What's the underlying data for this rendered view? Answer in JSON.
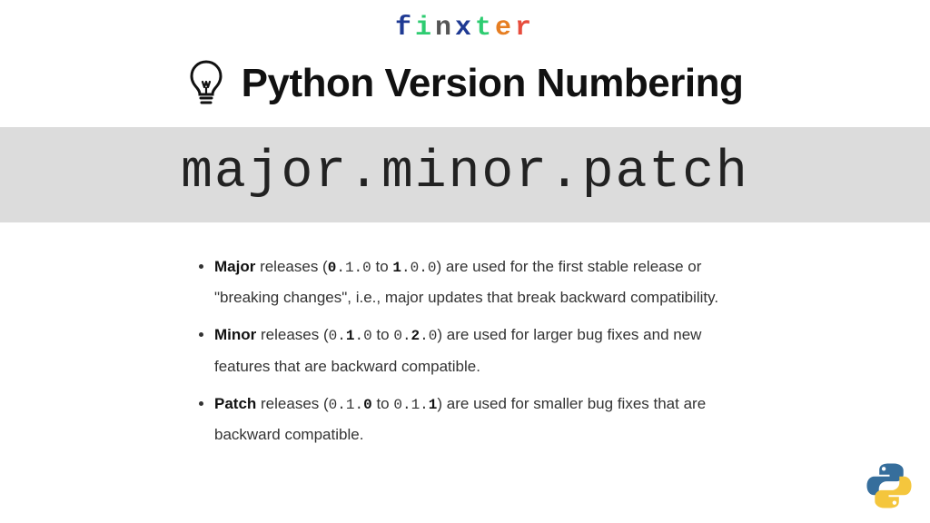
{
  "brand": {
    "letters": [
      "f",
      "i",
      "n",
      "x",
      "t",
      "e",
      "r"
    ],
    "colors": [
      "#1f3a93",
      "#2ecc71",
      "#555555",
      "#1f3a93",
      "#2ecc71",
      "#e67e22",
      "#e74c3c"
    ]
  },
  "title": "Python Version Numbering",
  "banner": "major.minor.patch",
  "items": [
    {
      "label": "Major",
      "from": "0.1.0",
      "to": "1.0.0",
      "bold_from": [
        0
      ],
      "bold_to": [
        0
      ],
      "desc_tail": "are used for the first stable release or \"breaking changes\", i.e., major updates that break backward compatibility."
    },
    {
      "label": "Minor",
      "from": "0.1.0",
      "to": "0.2.0",
      "bold_from": [
        2
      ],
      "bold_to": [
        2
      ],
      "desc_tail": "are used for larger bug fixes and new features that are backward compatible."
    },
    {
      "label": "Patch",
      "from": "0.1.0",
      "to": "0.1.1",
      "bold_from": [
        4
      ],
      "bold_to": [
        4
      ],
      "desc_tail": "are used for smaller bug fixes that are backward compatible."
    }
  ]
}
